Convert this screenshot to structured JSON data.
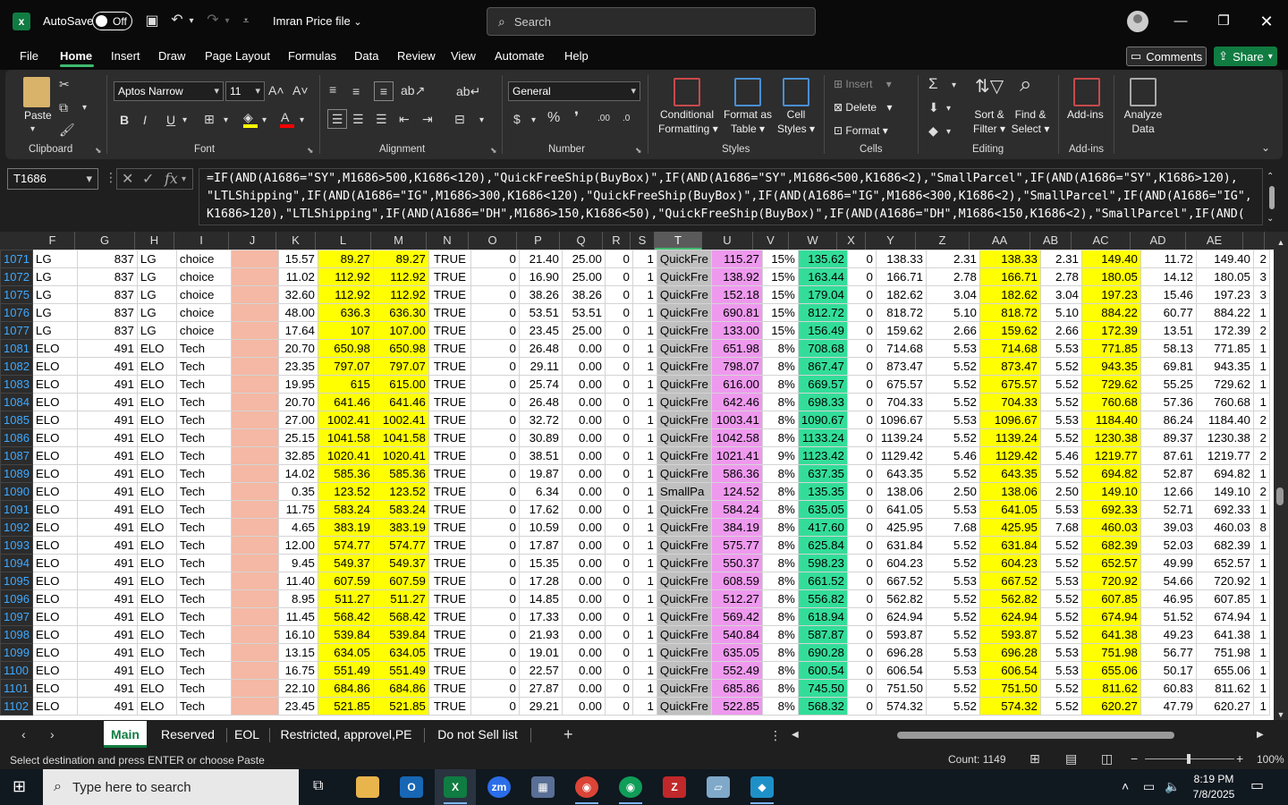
{
  "titlebar": {
    "autosave": "AutoSave",
    "toggle": "Off",
    "filename": "Imran Price file",
    "search_placeholder": "Search"
  },
  "menu": [
    "File",
    "Home",
    "Insert",
    "Draw",
    "Page Layout",
    "Formulas",
    "Data",
    "Review",
    "View",
    "Automate",
    "Help"
  ],
  "comments": "Comments",
  "share": "Share",
  "ribbon": {
    "paste": "Paste",
    "clipboard": "Clipboard",
    "font_name": "Aptos Narrow",
    "font_size": "11",
    "font": "Font",
    "alignment": "Alignment",
    "number_format": "General",
    "number": "Number",
    "conditional": [
      "Conditional",
      "Formatting"
    ],
    "format_table": [
      "Format as",
      "Table"
    ],
    "cell_styles": [
      "Cell",
      "Styles"
    ],
    "styles": "Styles",
    "insert": "Insert",
    "delete": "Delete",
    "format": "Format",
    "cells": "Cells",
    "sort": [
      "Sort &",
      "Filter"
    ],
    "find": [
      "Find &",
      "Select"
    ],
    "editing": "Editing",
    "addins": "Add-ins",
    "addins_group": "Add-ins",
    "analyze": [
      "Analyze",
      "Data"
    ]
  },
  "namebox": "T1686",
  "formula": [
    "=IF(AND(A1686=\"SY\",M1686>500,K1686<120),\"QuickFreeShip(BuyBox)\",IF(AND(A1686=\"SY\",M1686<500,K1686<2),\"SmallParcel\",IF(AND(A1686=\"SY\",K1686>120),",
    "\"LTLShipping\",IF(AND(A1686=\"IG\",M1686>300,K1686<120),\"QuickFreeShip(BuyBox)\",IF(AND(A1686=\"IG\",M1686<300,K1686<2),\"SmallParcel\",IF(AND(A1686=\"IG\",",
    "K1686>120),\"LTLShipping\",IF(AND(A1686=\"DH\",M1686>150,K1686<50),\"QuickFreeShip(BuyBox)\",IF(AND(A1686=\"DH\",M1686<150,K1686<2),\"SmallParcel\",IF(AND("
  ],
  "columns": [
    "F",
    "G",
    "H",
    "I",
    "J",
    "K",
    "L",
    "M",
    "N",
    "O",
    "P",
    "Q",
    "R",
    "S",
    "T",
    "U",
    "V",
    "W",
    "X",
    "Y",
    "Z",
    "AA",
    "AB",
    "AC",
    "AD",
    "AE"
  ],
  "rows": [
    [
      "1071",
      "LG",
      "837",
      "LG",
      "choice",
      "",
      "15.57",
      "89.27",
      "89.27",
      "TRUE",
      "0",
      "21.40",
      "25.00",
      "0",
      "1",
      "QuickFre",
      "115.27",
      "15%",
      "135.62",
      "0",
      "138.33",
      "2.31",
      "138.33",
      "2.31",
      "149.40",
      "11.72",
      "149.40",
      "2"
    ],
    [
      "1072",
      "LG",
      "837",
      "LG",
      "choice",
      "",
      "11.02",
      "112.92",
      "112.92",
      "TRUE",
      "0",
      "16.90",
      "25.00",
      "0",
      "1",
      "QuickFre",
      "138.92",
      "15%",
      "163.44",
      "0",
      "166.71",
      "2.78",
      "166.71",
      "2.78",
      "180.05",
      "14.12",
      "180.05",
      "3"
    ],
    [
      "1075",
      "LG",
      "837",
      "LG",
      "choice",
      "",
      "32.60",
      "112.92",
      "112.92",
      "TRUE",
      "0",
      "38.26",
      "38.26",
      "0",
      "1",
      "QuickFre",
      "152.18",
      "15%",
      "179.04",
      "0",
      "182.62",
      "3.04",
      "182.62",
      "3.04",
      "197.23",
      "15.46",
      "197.23",
      "3"
    ],
    [
      "1076",
      "LG",
      "837",
      "LG",
      "choice",
      "",
      "48.00",
      "636.3",
      "636.30",
      "TRUE",
      "0",
      "53.51",
      "53.51",
      "0",
      "1",
      "QuickFre",
      "690.81",
      "15%",
      "812.72",
      "0",
      "818.72",
      "5.10",
      "818.72",
      "5.10",
      "884.22",
      "60.77",
      "884.22",
      "1"
    ],
    [
      "1077",
      "LG",
      "837",
      "LG",
      "choice",
      "",
      "17.64",
      "107",
      "107.00",
      "TRUE",
      "0",
      "23.45",
      "25.00",
      "0",
      "1",
      "QuickFre",
      "133.00",
      "15%",
      "156.49",
      "0",
      "159.62",
      "2.66",
      "159.62",
      "2.66",
      "172.39",
      "13.51",
      "172.39",
      "2"
    ],
    [
      "1081",
      "ELO",
      "491",
      "ELO",
      "Tech",
      "",
      "20.70",
      "650.98",
      "650.98",
      "TRUE",
      "0",
      "26.48",
      "0.00",
      "0",
      "1",
      "QuickFre",
      "651.98",
      "8%",
      "708.68",
      "0",
      "714.68",
      "5.53",
      "714.68",
      "5.53",
      "771.85",
      "58.13",
      "771.85",
      "1"
    ],
    [
      "1082",
      "ELO",
      "491",
      "ELO",
      "Tech",
      "",
      "23.35",
      "797.07",
      "797.07",
      "TRUE",
      "0",
      "29.11",
      "0.00",
      "0",
      "1",
      "QuickFre",
      "798.07",
      "8%",
      "867.47",
      "0",
      "873.47",
      "5.52",
      "873.47",
      "5.52",
      "943.35",
      "69.81",
      "943.35",
      "1"
    ],
    [
      "1083",
      "ELO",
      "491",
      "ELO",
      "Tech",
      "",
      "19.95",
      "615",
      "615.00",
      "TRUE",
      "0",
      "25.74",
      "0.00",
      "0",
      "1",
      "QuickFre",
      "616.00",
      "8%",
      "669.57",
      "0",
      "675.57",
      "5.52",
      "675.57",
      "5.52",
      "729.62",
      "55.25",
      "729.62",
      "1"
    ],
    [
      "1084",
      "ELO",
      "491",
      "ELO",
      "Tech",
      "",
      "20.70",
      "641.46",
      "641.46",
      "TRUE",
      "0",
      "26.48",
      "0.00",
      "0",
      "1",
      "QuickFre",
      "642.46",
      "8%",
      "698.33",
      "0",
      "704.33",
      "5.52",
      "704.33",
      "5.52",
      "760.68",
      "57.36",
      "760.68",
      "1"
    ],
    [
      "1085",
      "ELO",
      "491",
      "ELO",
      "Tech",
      "",
      "27.00",
      "1002.41",
      "1002.41",
      "TRUE",
      "0",
      "32.72",
      "0.00",
      "0",
      "1",
      "QuickFre",
      "1003.41",
      "8%",
      "1090.67",
      "0",
      "1096.67",
      "5.53",
      "1096.67",
      "5.53",
      "1184.40",
      "86.24",
      "1184.40",
      "2"
    ],
    [
      "1086",
      "ELO",
      "491",
      "ELO",
      "Tech",
      "",
      "25.15",
      "1041.58",
      "1041.58",
      "TRUE",
      "0",
      "30.89",
      "0.00",
      "0",
      "1",
      "QuickFre",
      "1042.58",
      "8%",
      "1133.24",
      "0",
      "1139.24",
      "5.52",
      "1139.24",
      "5.52",
      "1230.38",
      "89.37",
      "1230.38",
      "2"
    ],
    [
      "1087",
      "ELO",
      "491",
      "ELO",
      "Tech",
      "",
      "32.85",
      "1020.41",
      "1020.41",
      "TRUE",
      "0",
      "38.51",
      "0.00",
      "0",
      "1",
      "QuickFre",
      "1021.41",
      "9%",
      "1123.42",
      "0",
      "1129.42",
      "5.46",
      "1129.42",
      "5.46",
      "1219.77",
      "87.61",
      "1219.77",
      "2"
    ],
    [
      "1089",
      "ELO",
      "491",
      "ELO",
      "Tech",
      "",
      "14.02",
      "585.36",
      "585.36",
      "TRUE",
      "0",
      "19.87",
      "0.00",
      "0",
      "1",
      "QuickFre",
      "586.36",
      "8%",
      "637.35",
      "0",
      "643.35",
      "5.52",
      "643.35",
      "5.52",
      "694.82",
      "52.87",
      "694.82",
      "1"
    ],
    [
      "1090",
      "ELO",
      "491",
      "ELO",
      "Tech",
      "",
      "0.35",
      "123.52",
      "123.52",
      "TRUE",
      "0",
      "6.34",
      "0.00",
      "0",
      "1",
      "SmallPa",
      "124.52",
      "8%",
      "135.35",
      "0",
      "138.06",
      "2.50",
      "138.06",
      "2.50",
      "149.10",
      "12.66",
      "149.10",
      "2"
    ],
    [
      "1091",
      "ELO",
      "491",
      "ELO",
      "Tech",
      "",
      "11.75",
      "583.24",
      "583.24",
      "TRUE",
      "0",
      "17.62",
      "0.00",
      "0",
      "1",
      "QuickFre",
      "584.24",
      "8%",
      "635.05",
      "0",
      "641.05",
      "5.53",
      "641.05",
      "5.53",
      "692.33",
      "52.71",
      "692.33",
      "1"
    ],
    [
      "1092",
      "ELO",
      "491",
      "ELO",
      "Tech",
      "",
      "4.65",
      "383.19",
      "383.19",
      "TRUE",
      "0",
      "10.59",
      "0.00",
      "0",
      "1",
      "QuickFre",
      "384.19",
      "8%",
      "417.60",
      "0",
      "425.95",
      "7.68",
      "425.95",
      "7.68",
      "460.03",
      "39.03",
      "460.03",
      "8"
    ],
    [
      "1093",
      "ELO",
      "491",
      "ELO",
      "Tech",
      "",
      "12.00",
      "574.77",
      "574.77",
      "TRUE",
      "0",
      "17.87",
      "0.00",
      "0",
      "1",
      "QuickFre",
      "575.77",
      "8%",
      "625.84",
      "0",
      "631.84",
      "5.52",
      "631.84",
      "5.52",
      "682.39",
      "52.03",
      "682.39",
      "1"
    ],
    [
      "1094",
      "ELO",
      "491",
      "ELO",
      "Tech",
      "",
      "9.45",
      "549.37",
      "549.37",
      "TRUE",
      "0",
      "15.35",
      "0.00",
      "0",
      "1",
      "QuickFre",
      "550.37",
      "8%",
      "598.23",
      "0",
      "604.23",
      "5.52",
      "604.23",
      "5.52",
      "652.57",
      "49.99",
      "652.57",
      "1"
    ],
    [
      "1095",
      "ELO",
      "491",
      "ELO",
      "Tech",
      "",
      "11.40",
      "607.59",
      "607.59",
      "TRUE",
      "0",
      "17.28",
      "0.00",
      "0",
      "1",
      "QuickFre",
      "608.59",
      "8%",
      "661.52",
      "0",
      "667.52",
      "5.53",
      "667.52",
      "5.53",
      "720.92",
      "54.66",
      "720.92",
      "1"
    ],
    [
      "1096",
      "ELO",
      "491",
      "ELO",
      "Tech",
      "",
      "8.95",
      "511.27",
      "511.27",
      "TRUE",
      "0",
      "14.85",
      "0.00",
      "0",
      "1",
      "QuickFre",
      "512.27",
      "8%",
      "556.82",
      "0",
      "562.82",
      "5.52",
      "562.82",
      "5.52",
      "607.85",
      "46.95",
      "607.85",
      "1"
    ],
    [
      "1097",
      "ELO",
      "491",
      "ELO",
      "Tech",
      "",
      "11.45",
      "568.42",
      "568.42",
      "TRUE",
      "0",
      "17.33",
      "0.00",
      "0",
      "1",
      "QuickFre",
      "569.42",
      "8%",
      "618.94",
      "0",
      "624.94",
      "5.52",
      "624.94",
      "5.52",
      "674.94",
      "51.52",
      "674.94",
      "1"
    ],
    [
      "1098",
      "ELO",
      "491",
      "ELO",
      "Tech",
      "",
      "16.10",
      "539.84",
      "539.84",
      "TRUE",
      "0",
      "21.93",
      "0.00",
      "0",
      "1",
      "QuickFre",
      "540.84",
      "8%",
      "587.87",
      "0",
      "593.87",
      "5.52",
      "593.87",
      "5.52",
      "641.38",
      "49.23",
      "641.38",
      "1"
    ],
    [
      "1099",
      "ELO",
      "491",
      "ELO",
      "Tech",
      "",
      "13.15",
      "634.05",
      "634.05",
      "TRUE",
      "0",
      "19.01",
      "0.00",
      "0",
      "1",
      "QuickFre",
      "635.05",
      "8%",
      "690.28",
      "0",
      "696.28",
      "5.53",
      "696.28",
      "5.53",
      "751.98",
      "56.77",
      "751.98",
      "1"
    ],
    [
      "1100",
      "ELO",
      "491",
      "ELO",
      "Tech",
      "",
      "16.75",
      "551.49",
      "551.49",
      "TRUE",
      "0",
      "22.57",
      "0.00",
      "0",
      "1",
      "QuickFre",
      "552.49",
      "8%",
      "600.54",
      "0",
      "606.54",
      "5.53",
      "606.54",
      "5.53",
      "655.06",
      "50.17",
      "655.06",
      "1"
    ],
    [
      "1101",
      "ELO",
      "491",
      "ELO",
      "Tech",
      "",
      "22.10",
      "684.86",
      "684.86",
      "TRUE",
      "0",
      "27.87",
      "0.00",
      "0",
      "1",
      "QuickFre",
      "685.86",
      "8%",
      "745.50",
      "0",
      "751.50",
      "5.52",
      "751.50",
      "5.52",
      "811.62",
      "60.83",
      "811.62",
      "1"
    ],
    [
      "1102",
      "ELO",
      "491",
      "ELO",
      "Tech",
      "",
      "23.45",
      "521.85",
      "521.85",
      "TRUE",
      "0",
      "29.21",
      "0.00",
      "0",
      "1",
      "QuickFre",
      "522.85",
      "8%",
      "568.32",
      "0",
      "574.32",
      "5.52",
      "574.32",
      "5.52",
      "620.27",
      "47.79",
      "620.27",
      "1"
    ]
  ],
  "tabs": [
    "Main",
    "Reserved",
    "EOL",
    "Restricted, approvel,PE",
    "Do not Sell list"
  ],
  "status": {
    "message": "Select destination and press ENTER or choose Paste",
    "count": "Count: 1149",
    "zoom": "100%"
  },
  "taskbar": {
    "search": "Type here to search",
    "time": "8:19 PM",
    "date": "7/8/2025"
  }
}
